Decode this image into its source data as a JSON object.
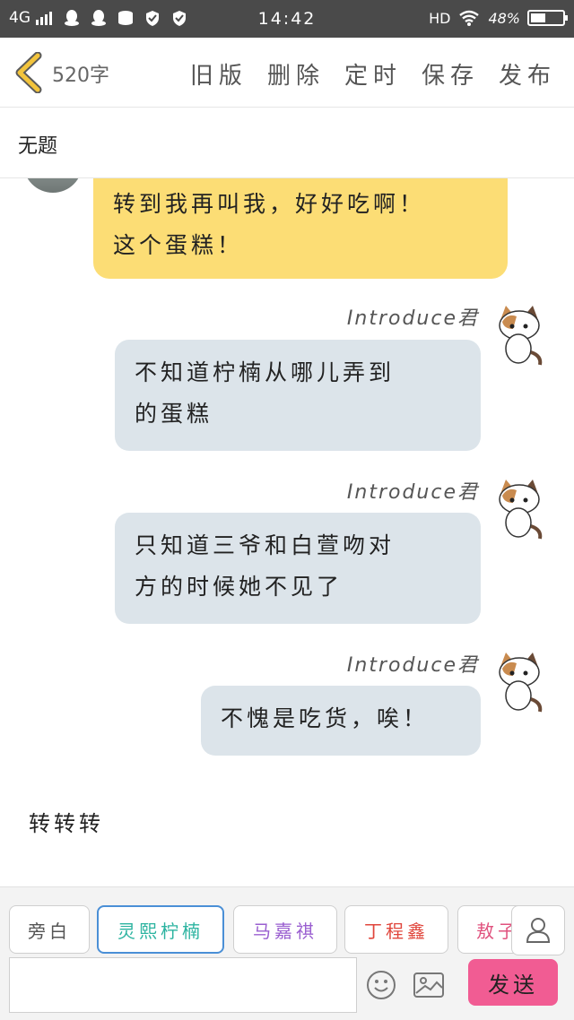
{
  "status_bar": {
    "network": "4G",
    "time": "14:42",
    "hd": "HD",
    "battery": "48%",
    "battery_level": 0.48
  },
  "header": {
    "word_count": "520字",
    "actions": [
      "旧版",
      "删除",
      "定时",
      "保存",
      "发布"
    ]
  },
  "title": "无题",
  "messages": [
    {
      "side": "left",
      "text": "转到我再叫我，好好吃啊！这个蛋糕！",
      "lines": [
        "转到我再叫我，好好吃啊！",
        "这个蛋糕！"
      ],
      "color": "#fcdd75"
    },
    {
      "side": "right",
      "name": "Introduce君",
      "lines": [
        "不知道柠楠从哪儿弄到",
        "的蛋糕"
      ],
      "color": "#dce4ea"
    },
    {
      "side": "right",
      "name": "Introduce君",
      "lines": [
        "只知道三爷和白萱吻对",
        "方的时候她不见了"
      ],
      "color": "#dce4ea"
    },
    {
      "side": "right",
      "name": "Introduce君",
      "lines": [
        "不愧是吃货，唉！"
      ],
      "color": "#dce4ea"
    }
  ],
  "plain_text": "转转转",
  "characters": [
    {
      "label": "旁白",
      "color": "#555555"
    },
    {
      "label": "灵熙柠楠",
      "color": "#2bb3a0"
    },
    {
      "label": "马嘉祺",
      "color": "#9a5fd0"
    },
    {
      "label": "丁程鑫",
      "color": "#e0463c"
    },
    {
      "label": "敖子",
      "color": "#e0527e"
    }
  ],
  "input": {
    "value": "",
    "placeholder": ""
  },
  "send_label": "发送",
  "colors": {
    "accent_send": "#f15c93",
    "bubble_yellow": "#fcdd75",
    "bubble_grey": "#dce4ea",
    "back_arrow": "#f3c43c"
  }
}
